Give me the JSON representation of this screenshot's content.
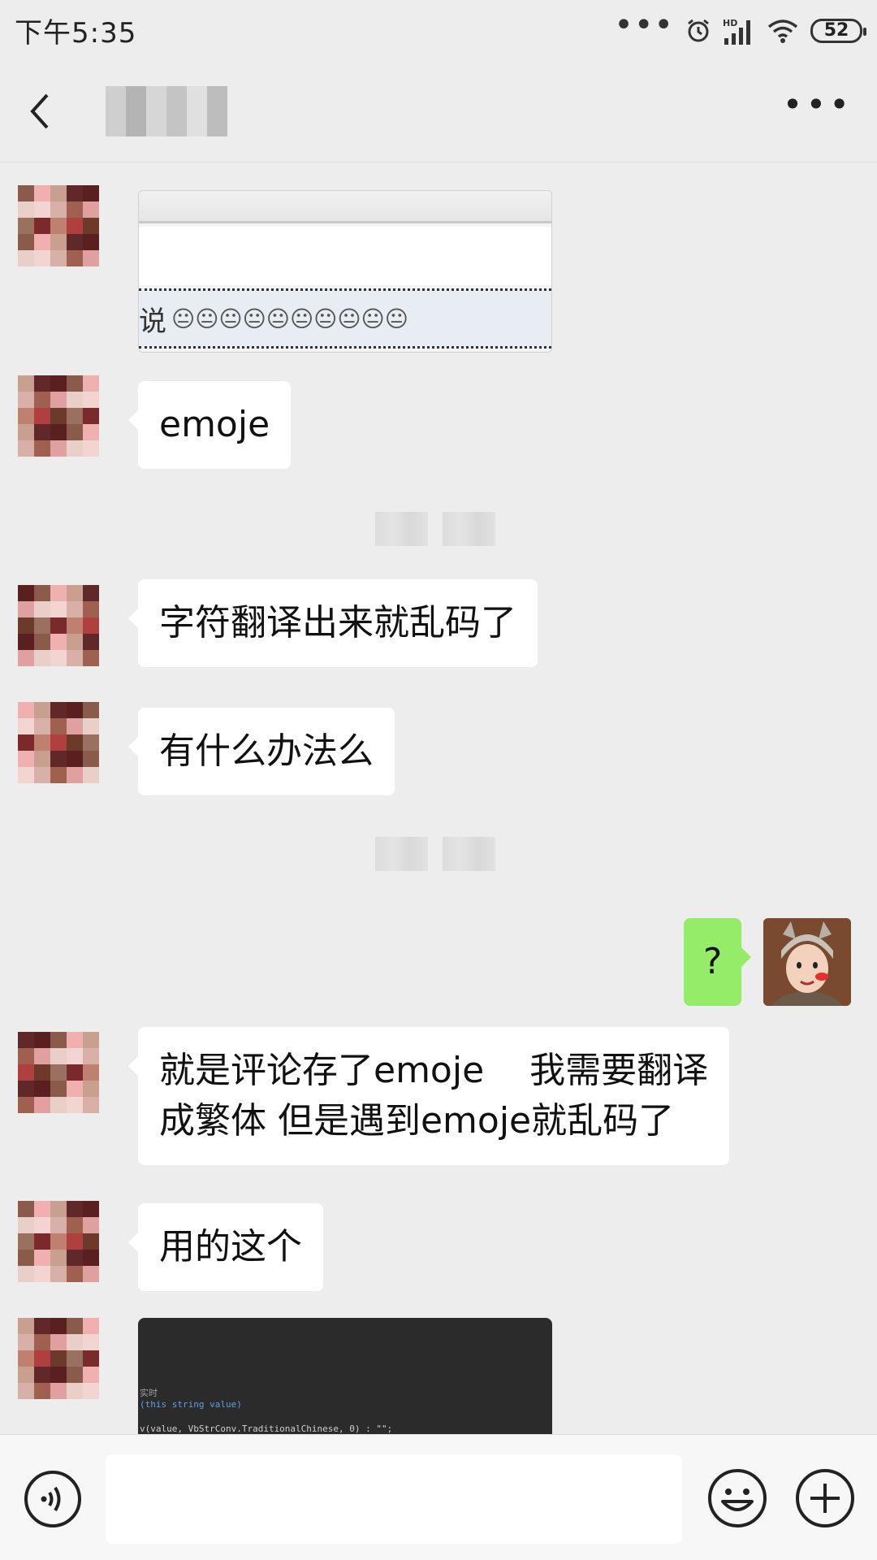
{
  "status_bar": {
    "time": "下午5:35",
    "network_label": "HD",
    "battery": "52"
  },
  "header": {
    "contact_name": "",
    "back_icon": "chevron-left-icon",
    "more_icon": "more-icon"
  },
  "messages": [
    {
      "type": "image",
      "sender": "contact",
      "caption_text": "说",
      "faces": "😐😐😐😐😐😐😐😐😐😐"
    },
    {
      "type": "text",
      "sender": "contact",
      "text": "emoje"
    },
    {
      "type": "timestamp",
      "text": ""
    },
    {
      "type": "text",
      "sender": "contact",
      "text": "字符翻译出来就乱码了"
    },
    {
      "type": "text",
      "sender": "contact",
      "text": "有什么办法么"
    },
    {
      "type": "timestamp",
      "text": ""
    },
    {
      "type": "text",
      "sender": "me",
      "text": "?"
    },
    {
      "type": "text",
      "sender": "contact",
      "text": "就是评论存了emoje    我需要翻译\n成繁体 但是遇到emoje就乱码了"
    },
    {
      "type": "text",
      "sender": "contact",
      "text": "用的这个"
    },
    {
      "type": "image",
      "sender": "contact",
      "code_lines": [
        "实时",
        "(this string value)",
        "v(value, VbStrConv.TraditionalChinese, 0) : \"\";"
      ]
    }
  ],
  "input_bar": {
    "placeholder": "",
    "voice_icon": "voice-icon",
    "emoji_icon": "emoji-icon",
    "plus_icon": "plus-icon"
  },
  "colors": {
    "background": "#ededed",
    "my_bubble": "#95ec69",
    "their_bubble": "#ffffff"
  }
}
